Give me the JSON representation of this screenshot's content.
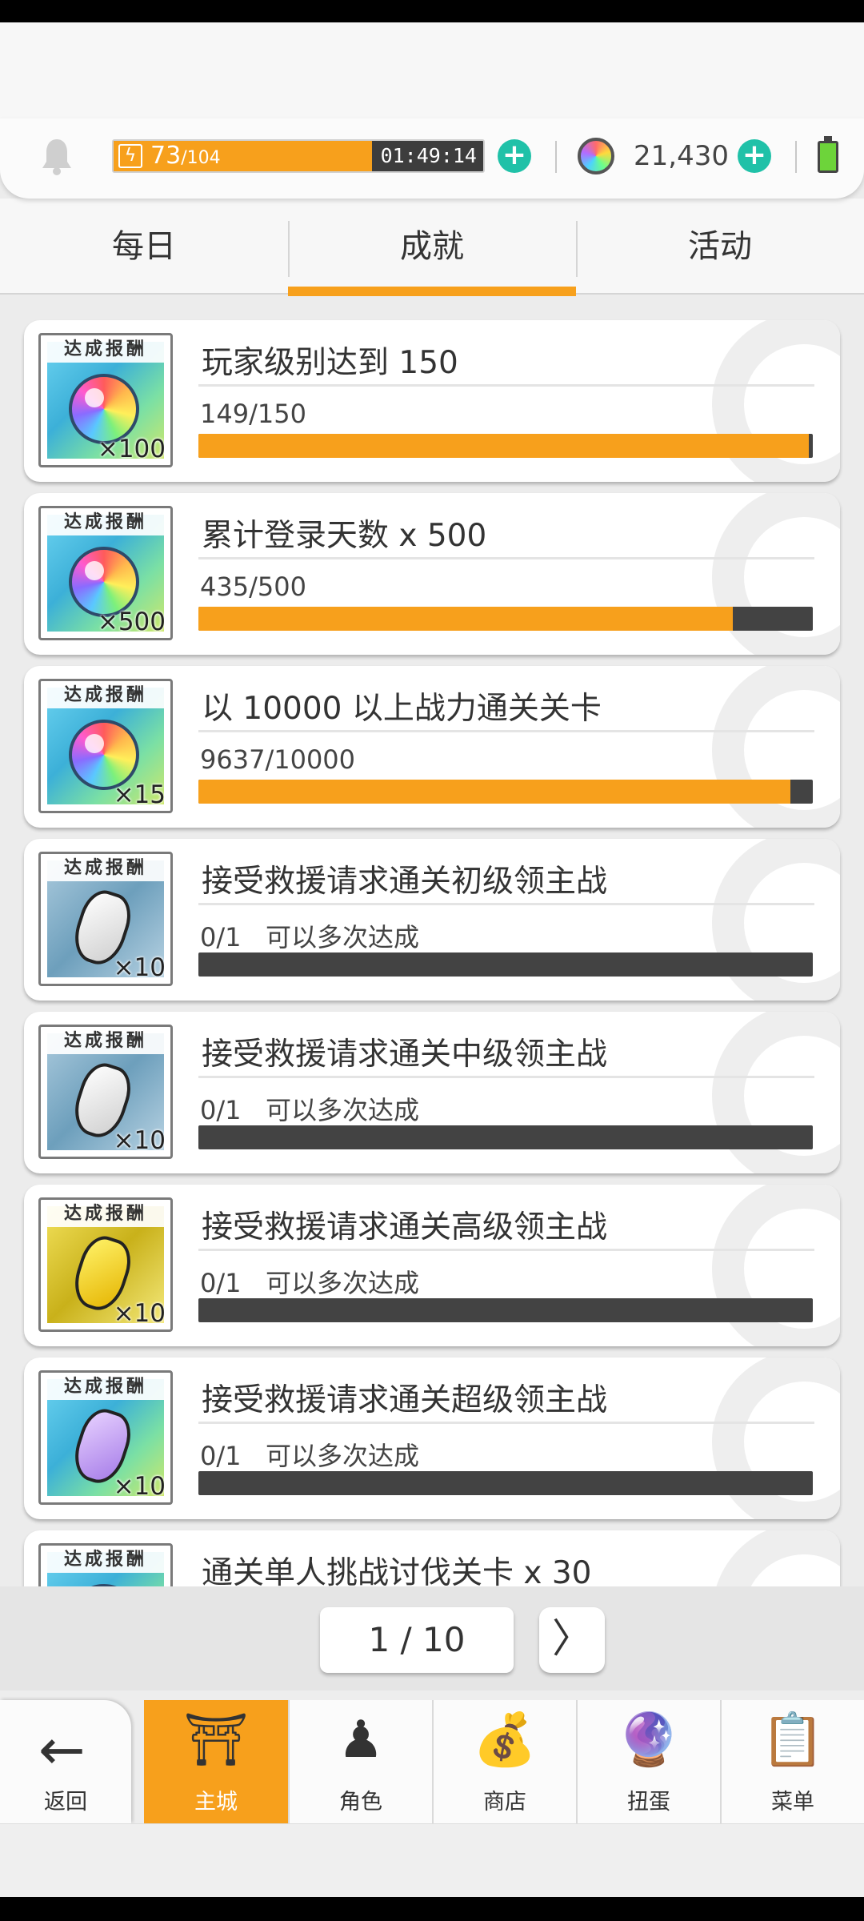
{
  "header": {
    "stamina_current": "73",
    "stamina_max": "/104",
    "stamina_fraction": 0.7,
    "stamina_timer": "01:49:14",
    "gem_count": "21,430"
  },
  "tabs": [
    {
      "label": "每日"
    },
    {
      "label": "成就"
    },
    {
      "label": "活动"
    }
  ],
  "reward_label": "达成报酬",
  "achievements": [
    {
      "title": "玩家级别达到 150",
      "progress": "149/150",
      "note": "",
      "fraction": 0.993,
      "reward": "rainbow-orb",
      "qty": "×100"
    },
    {
      "title": "累计登录天数 x 500",
      "progress": "435/500",
      "note": "",
      "fraction": 0.87,
      "reward": "rainbow-orb",
      "qty": "×500"
    },
    {
      "title": "以 10000 以上战力通关关卡",
      "progress": "9637/10000",
      "note": "",
      "fraction": 0.9637,
      "reward": "rainbow-orb",
      "qty": "×15"
    },
    {
      "title": "接受救援请求通关初级领主战",
      "progress": "0/1",
      "note": "可以多次达成",
      "fraction": 0,
      "reward": "white-shard",
      "qty": "×10"
    },
    {
      "title": "接受救援请求通关中级领主战",
      "progress": "0/1",
      "note": "可以多次达成",
      "fraction": 0,
      "reward": "white-shard",
      "qty": "×10"
    },
    {
      "title": "接受救援请求通关高级领主战",
      "progress": "0/1",
      "note": "可以多次达成",
      "fraction": 0,
      "reward": "yellow-shard",
      "qty": "×10"
    },
    {
      "title": "接受救援请求通关超级领主战",
      "progress": "0/1",
      "note": "可以多次达成",
      "fraction": 0,
      "reward": "purple-shard",
      "qty": "×10"
    },
    {
      "title": "通关单人挑战讨伐关卡  x 30",
      "progress": "",
      "note": "",
      "fraction": 0,
      "reward": "rainbow-orb",
      "qty": ""
    }
  ],
  "pager": {
    "indicator": "1 / 10",
    "next_glyph": "〉"
  },
  "nav": {
    "back_label": "返回",
    "items": [
      {
        "label": "主城",
        "icon": "castle-icon",
        "glyph": "⛩",
        "active": true
      },
      {
        "label": "角色",
        "icon": "character-icon",
        "glyph": "♟",
        "active": false
      },
      {
        "label": "商店",
        "icon": "shop-icon",
        "glyph": "💰",
        "active": false
      },
      {
        "label": "扭蛋",
        "icon": "gacha-icon",
        "glyph": "🔮",
        "active": false
      },
      {
        "label": "菜单",
        "icon": "menu-icon",
        "glyph": "📋",
        "active": false
      }
    ]
  },
  "colors": {
    "accent": "#f7a01c",
    "bar_empty": "#434343",
    "plus_button": "#20c1a8"
  }
}
